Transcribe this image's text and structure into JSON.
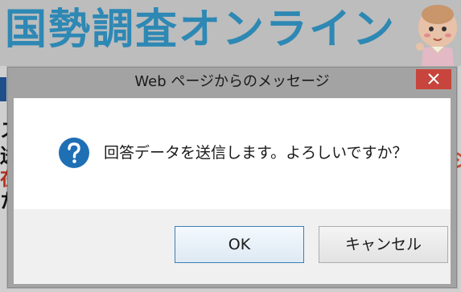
{
  "background": {
    "site_title": "国勢調査オンライン",
    "left_glyphs": [
      "ス",
      "送",
      "在",
      "た"
    ],
    "right_mark": "ジ"
  },
  "dialog": {
    "title": "Web ページからのメッセージ",
    "message": "回答データを送信します。よろしいですか？",
    "ok_label": "OK",
    "cancel_label": "キャンセル",
    "close_symbol": "✕",
    "icon": "question-icon"
  },
  "colors": {
    "title_blue": "#2e88b4",
    "close_red": "#c7453c",
    "icon_blue": "#1f6fb5"
  }
}
